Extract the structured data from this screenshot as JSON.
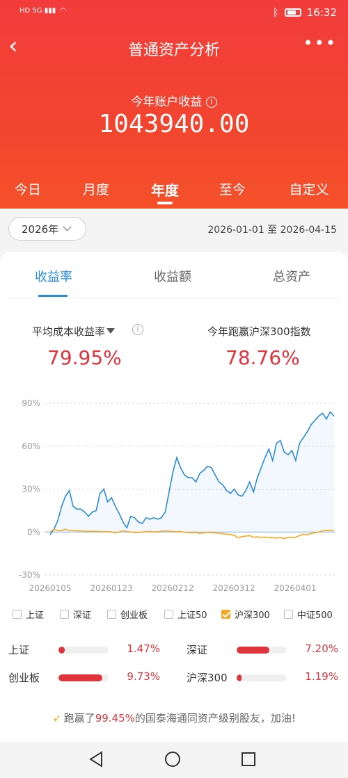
{
  "status": {
    "time": "16:32",
    "left_icons": "HD 5G ▮▮▮"
  },
  "nav": {
    "title": "普通资产分析",
    "more": "•••"
  },
  "summary": {
    "label": "今年账户收益",
    "value": "1043940.00"
  },
  "period_tabs": [
    "今日",
    "月度",
    "年度",
    "至今",
    "自定义"
  ],
  "period_active": 2,
  "year_select": "2026年",
  "date_range": "2026-01-01 至 2026-04-15",
  "metric_tabs": [
    "收益率",
    "收益额",
    "总资产"
  ],
  "metric_active": 0,
  "stats": {
    "left_label": "平均成本收益率",
    "left_value": "79.95%",
    "right_label": "今年跑赢沪深300指数",
    "right_value": "78.76%"
  },
  "chart_data": {
    "type": "line",
    "ylim": [
      -30,
      90
    ],
    "yticks": [
      "90%",
      "60%",
      "30%",
      "0%",
      "-30%"
    ],
    "xticks": [
      "20260105",
      "20260123",
      "20260212",
      "20260312",
      "20260401"
    ],
    "series": [
      {
        "name": "收益率",
        "color": "#2a8bd8",
        "values": [
          -2,
          2,
          8,
          18,
          25,
          29,
          18,
          16,
          16,
          14,
          11,
          14,
          15,
          27,
          30,
          21,
          24,
          18,
          13,
          7,
          3,
          11,
          10,
          7,
          6,
          10,
          9,
          10,
          9,
          10,
          14,
          28,
          42,
          52,
          45,
          40,
          38,
          38,
          35,
          41,
          43,
          46,
          45,
          40,
          35,
          33,
          29,
          27,
          30,
          26,
          25,
          29,
          35,
          28,
          38,
          45,
          52,
          58,
          50,
          62,
          64,
          56,
          54,
          57,
          50,
          62,
          66,
          70,
          75,
          78,
          81,
          83,
          79,
          84,
          81
        ]
      },
      {
        "name": "沪深300",
        "color": "#f5a623",
        "values": [
          0,
          2,
          1,
          1,
          2,
          1,
          1,
          0.8,
          0.8,
          0.6,
          0.5,
          0.5,
          0.5,
          0.4,
          0.3,
          0.3,
          0.1,
          -0.5,
          0,
          1,
          0.3,
          0.1,
          -0.4,
          -0.2,
          0,
          0.3,
          0.4,
          0.1,
          0.2,
          0.6,
          0.8,
          0.6,
          0.4,
          0.2,
          0.4,
          -0.2,
          -0.3,
          -0.6,
          -0.3,
          -1,
          -0.5,
          -0.2,
          -0.4,
          -0.6,
          -0.8,
          -1.2,
          -1.5,
          -1.8,
          -2.2,
          -4,
          -3.2,
          -2.8,
          -2.5,
          -3.6,
          -3.3,
          -3.8,
          -3.5,
          -4,
          -3.9,
          -4.2,
          -3.8,
          -4.5,
          -3.8,
          -4,
          -3.6,
          -2.5,
          -1.5,
          -2,
          -1,
          -0.5,
          0,
          0.8,
          1.2,
          1.1,
          1.2
        ]
      }
    ]
  },
  "legend": [
    {
      "label": "上证",
      "checked": false
    },
    {
      "label": "深证",
      "checked": false
    },
    {
      "label": "创业板",
      "checked": false
    },
    {
      "label": "上证50",
      "checked": false
    },
    {
      "label": "沪深300",
      "checked": true
    },
    {
      "label": "中证500",
      "checked": false
    }
  ],
  "compare": [
    {
      "label": "上证",
      "value": "1.47%",
      "fill": 0.12
    },
    {
      "label": "深证",
      "value": "7.20%",
      "fill": 0.65
    },
    {
      "label": "创业板",
      "value": "9.73%",
      "fill": 0.88
    },
    {
      "label": "沪深300",
      "value": "1.19%",
      "fill": 0.1
    }
  ],
  "footer": {
    "prefix": "跑赢了",
    "pct": "99.45%",
    "suffix": "的国泰海通同资产级别股友，加油!"
  },
  "colors": {
    "header": "#f23c3c",
    "accent": "#e0343d",
    "blue": "#2a8bd8",
    "orange": "#f5a623"
  }
}
